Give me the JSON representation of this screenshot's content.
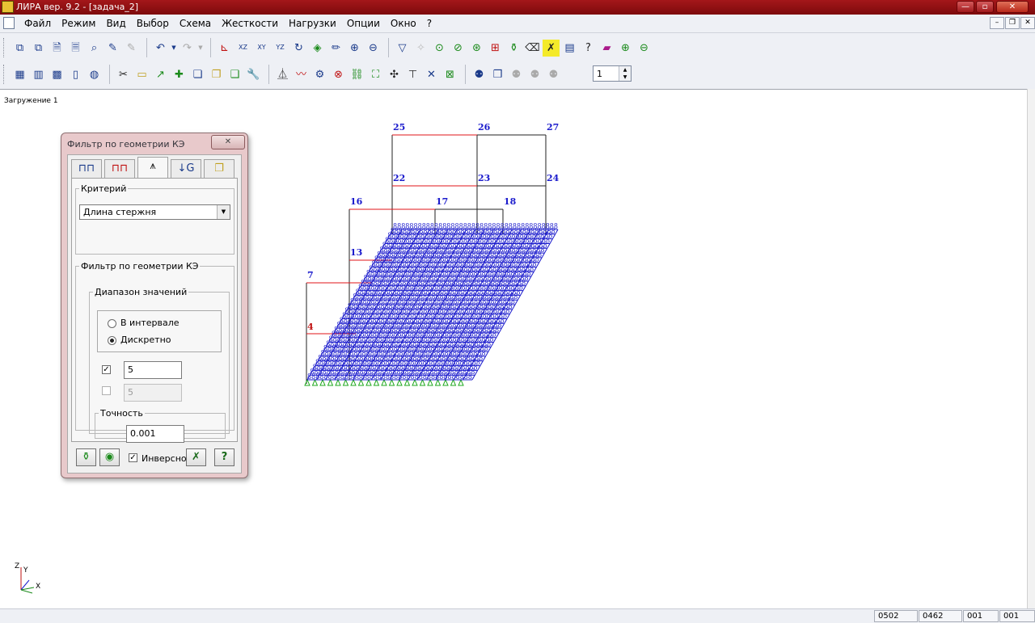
{
  "window": {
    "title": "ЛИРА  вер. 9.2 - [задача_2]",
    "minimize": "—",
    "maximize": "▫",
    "close": "✕"
  },
  "menu": {
    "items": [
      "Файл",
      "Режим",
      "Вид",
      "Выбор",
      "Схема",
      "Жесткости",
      "Нагрузки",
      "Опции",
      "Окно",
      "?"
    ],
    "mdi_minimize": "–",
    "mdi_restore": "❐",
    "mdi_close": "✕"
  },
  "toolbar": {
    "step_value": "1"
  },
  "canvas": {
    "load_case": "Загружение  1",
    "node_labels": [
      "25",
      "26",
      "27",
      "22",
      "23",
      "24",
      "16",
      "17",
      "18",
      "13",
      "7",
      "4"
    ],
    "axis": {
      "z": "Z",
      "y": "Y",
      "x": "X"
    }
  },
  "dialog": {
    "title": "Фильтр по геометрии КЭ",
    "close": "✕",
    "tabs": [
      "nodes-tab-icon",
      "elements-tab-icon",
      "geometry-tab-icon",
      "sort-tab-icon",
      "select-tab-icon"
    ],
    "criterion_legend": "Критерий",
    "criterion_value": "Длина стержня",
    "filter_legend": "Фильтр по геометрии КЭ",
    "range_legend": "Диапазон значений",
    "radio_interval": "В интервале",
    "radio_discrete": "Дискретно",
    "value1": "5",
    "value2": "5",
    "precision_legend": "Точность",
    "precision_value": "0.001",
    "inverse_label": "Инверсно"
  },
  "statusbar": {
    "panels": [
      "0502",
      "0462",
      "001",
      "001"
    ]
  },
  "colors": {
    "titlebar": "#8e1012",
    "node_label": "#1a1acc",
    "highlight": "#e0141a",
    "mesh": "#1a1acc",
    "support": "#22aa22"
  }
}
